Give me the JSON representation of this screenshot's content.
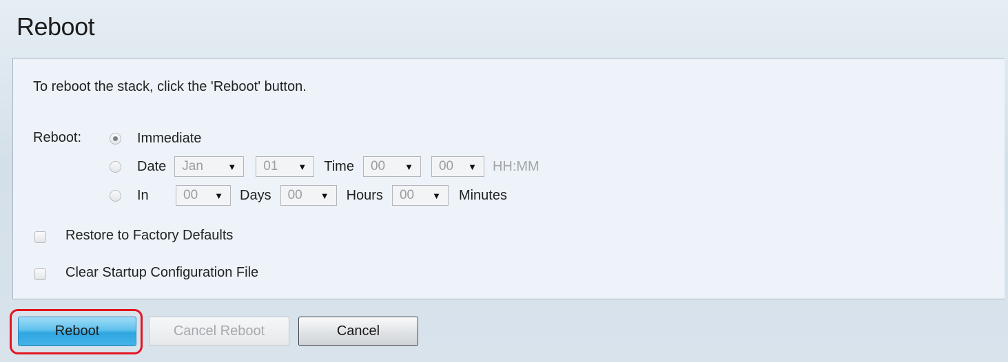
{
  "page": {
    "title": "Reboot"
  },
  "panel": {
    "instructions": "To reboot the stack, click the 'Reboot' button.",
    "reboot_label": "Reboot:",
    "options": {
      "immediate": {
        "label": "Immediate",
        "checked": true
      },
      "date": {
        "label": "Date",
        "month": "Jan",
        "day": "01",
        "time_label": "Time",
        "hour": "00",
        "minute": "00",
        "format_hint": "HH:MM"
      },
      "in": {
        "label": "In",
        "days": "00",
        "days_label": "Days",
        "hours": "00",
        "hours_label": "Hours",
        "minutes": "00",
        "minutes_label": "Minutes"
      }
    },
    "restore_factory_defaults": {
      "label": "Restore to Factory Defaults",
      "checked": false
    },
    "clear_startup_config": {
      "label": "Clear Startup Configuration File",
      "checked": false
    }
  },
  "buttons": {
    "reboot": "Reboot",
    "cancel_reboot": "Cancel Reboot",
    "cancel": "Cancel"
  },
  "colors": {
    "primary_button": "#45b3e8",
    "highlight_outline": "#e4141f"
  },
  "icons": {
    "dropdown_arrow": "▼"
  }
}
